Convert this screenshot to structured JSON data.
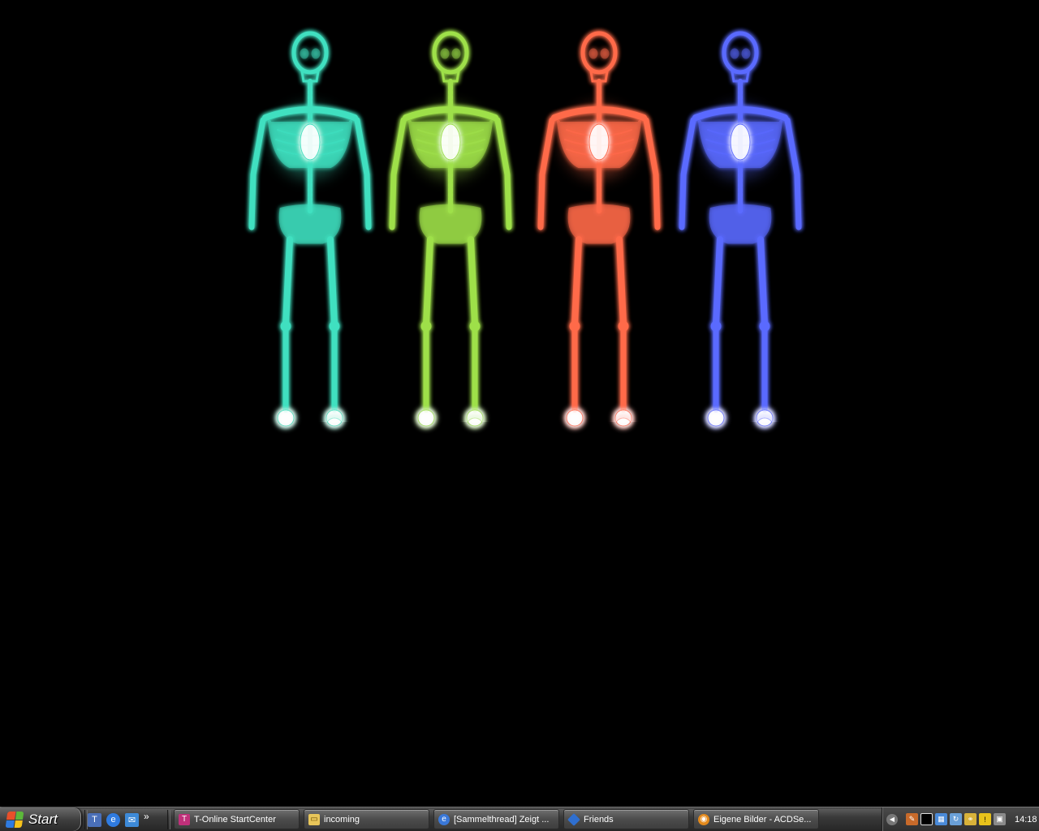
{
  "start": {
    "label": "Start"
  },
  "quick_launch": {
    "icons": [
      "t-online-icon",
      "internet-explorer-icon",
      "outlook-express-icon"
    ],
    "more": "»"
  },
  "taskbar": {
    "tasks": [
      {
        "label": "T-Online StartCenter",
        "icon": "t-online-icon",
        "color": "#c0307a"
      },
      {
        "label": "incoming",
        "icon": "folder-icon",
        "color": "#e8c65a"
      },
      {
        "label": "[Sammelthread] Zeigt ...",
        "icon": "internet-explorer-icon",
        "color": "#3a78d8"
      },
      {
        "label": "Friends",
        "icon": "messenger-icon",
        "color": "#2f6fd0"
      },
      {
        "label": "Eigene Bilder - ACDSe...",
        "icon": "acdsee-icon",
        "color": "#e48a1c"
      }
    ]
  },
  "tray": {
    "icons": [
      "edit-icon",
      "black-square-icon",
      "network-icon",
      "sync-icon",
      "connection-icon",
      "warning-icon",
      "device-icon"
    ],
    "clock": "14:18"
  },
  "wallpaper": {
    "description_colors": {
      "skeleton_1": "#3fe0c0",
      "skeleton_2": "#9ee04a",
      "skeleton_3": "#ff6a4a",
      "skeleton_4": "#5a6aff"
    }
  }
}
